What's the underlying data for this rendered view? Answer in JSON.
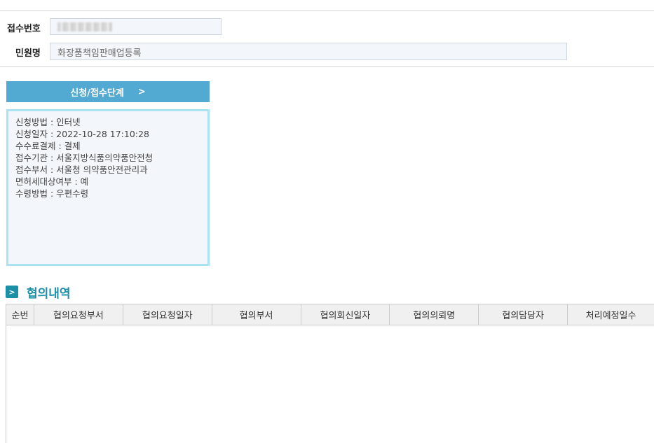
{
  "receipt": {
    "number_label": "접수번호",
    "name_label": "민원명",
    "name_value": "화장품책임판매업등록"
  },
  "stage": {
    "label": "신청/접수단계",
    "arrow": ">"
  },
  "details": [
    "신청방법 : 인터넷",
    "신청일자 : 2022-10-28 17:10:28",
    "수수료결제 : 결제",
    "접수기관 : 서울지방식품의약품안전청",
    "접수부서 : 서울청 의약품안전관리과",
    "면허세대상여부 : 예",
    "수령방법 : 우편수령"
  ],
  "consultation": {
    "title": "협의내역",
    "icon": "chevron-right-icon",
    "columns": [
      "순번",
      "협의요청부서",
      "협의요청일자",
      "협의부서",
      "협의회신일자",
      "협의의뢰명",
      "협의담당자",
      "처리예정일수"
    ],
    "rows": []
  }
}
